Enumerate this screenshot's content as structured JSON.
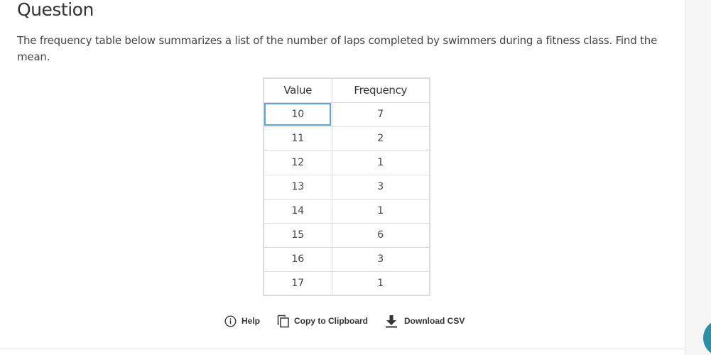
{
  "question": {
    "heading": "Question",
    "text": "The frequency table below summarizes a list of the number of laps completed by swimmers during a fitness class. Find the mean."
  },
  "table": {
    "headers": [
      "Value",
      "Frequency"
    ],
    "rows": [
      {
        "value": "10",
        "frequency": "7"
      },
      {
        "value": "11",
        "frequency": "2"
      },
      {
        "value": "12",
        "frequency": "1"
      },
      {
        "value": "13",
        "frequency": "3"
      },
      {
        "value": "14",
        "frequency": "1"
      },
      {
        "value": "15",
        "frequency": "6"
      },
      {
        "value": "16",
        "frequency": "3"
      },
      {
        "value": "17",
        "frequency": "1"
      }
    ]
  },
  "toolbar": {
    "help_label": "Help",
    "copy_label": "Copy to Clipboard",
    "download_label": "Download CSV",
    "icons": [
      "info-circle-icon",
      "copy-icon",
      "download-icon"
    ]
  },
  "colors": {
    "selected_cell_border": "#5aa5dc",
    "fab": "#2b8fa6"
  }
}
